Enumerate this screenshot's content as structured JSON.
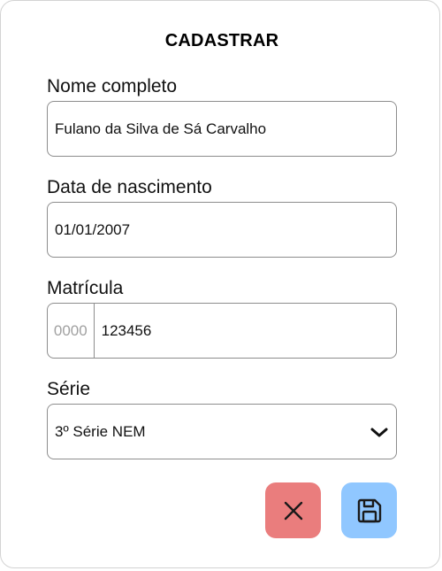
{
  "form": {
    "title": "CADASTRAR",
    "fields": {
      "nome": {
        "label": "Nome completo",
        "value": "Fulano da Silva de Sá Carvalho"
      },
      "nascimento": {
        "label": "Data de nascimento",
        "value": "01/01/2007"
      },
      "matricula": {
        "label": "Matrícula",
        "prefix": "0000",
        "value": "123456"
      },
      "serie": {
        "label": "Série",
        "selected": "3º Série NEM"
      }
    },
    "buttons": {
      "cancel_icon": "close-icon",
      "save_icon": "save-icon"
    },
    "colors": {
      "cancel_bg": "#ea7d7d",
      "save_bg": "#90c7ff",
      "border": "#8d8d8d",
      "placeholder": "#a0a0a0"
    }
  }
}
